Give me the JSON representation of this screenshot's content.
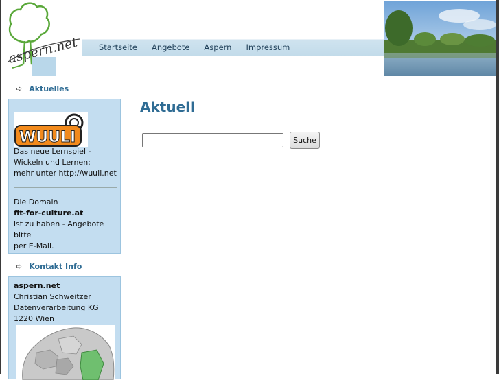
{
  "header": {
    "logo_text": "aspern.net",
    "nav": [
      "Startseite",
      "Angebote",
      "Aspern",
      "Impressum"
    ]
  },
  "sidebar": {
    "news_heading": "Aktuelles",
    "news_box": {
      "wuuli_logo_text": "WUULI",
      "lines_1": [
        "Das neue Lernspiel -",
        "Wickeln und Lernen:",
        "mehr unter http://wuuli.net"
      ],
      "domain_intro": "Die Domain",
      "domain_name": "fit-for-culture.at",
      "domain_lines": [
        "ist zu haben - Angebote bitte",
        "per E-Mail."
      ]
    },
    "contact_heading": "Kontakt Info",
    "contact_box": {
      "company": "aspern.net",
      "lines": [
        "Christian Schweitzer",
        "Datenverarbeitung KG",
        "1220 Wien"
      ]
    }
  },
  "main": {
    "title": "Aktuell",
    "search_value": "",
    "search_button": "Suche"
  },
  "colors": {
    "heading_blue": "#2f6c94",
    "box_bg": "#c3ddf0",
    "nav_band": "#c8deec"
  }
}
